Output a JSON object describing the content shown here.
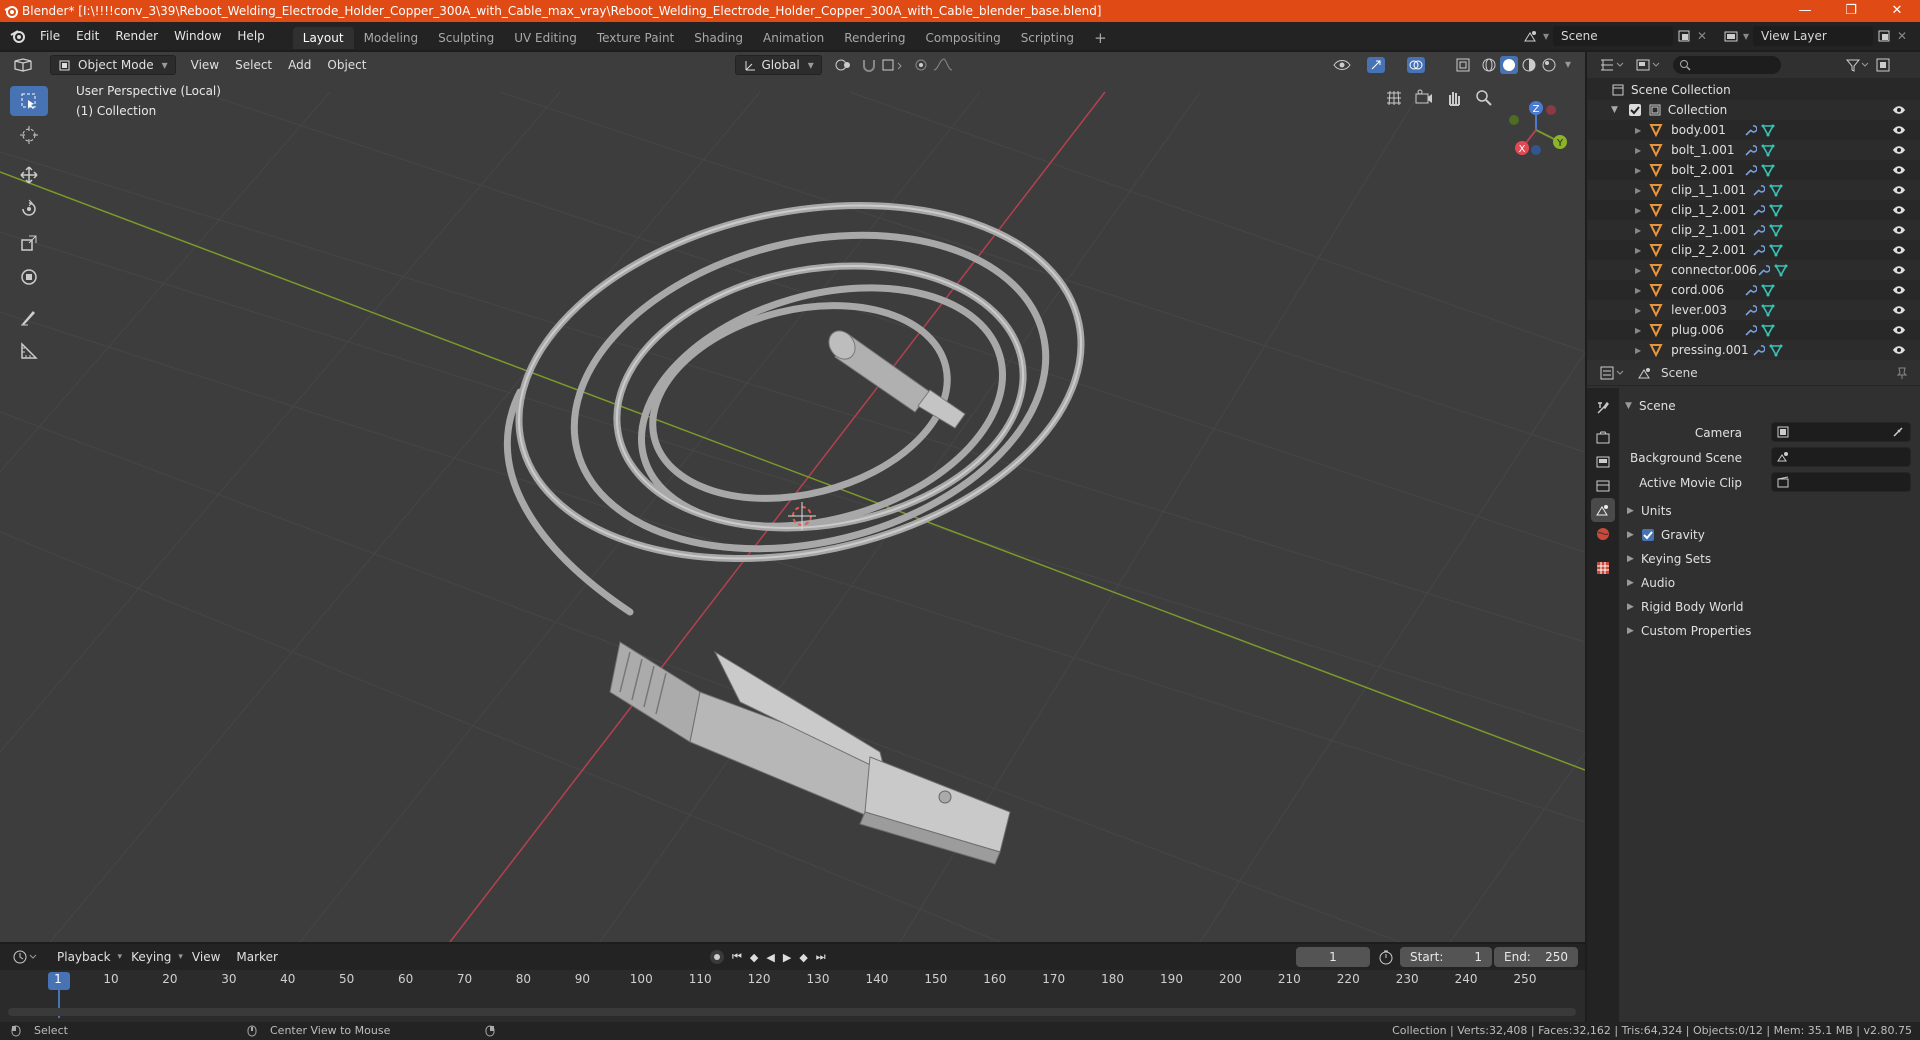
{
  "window": {
    "title": "Blender* [I:\\!!!!conv_3\\39\\Reboot_Welding_Electrode_Holder_Copper_300A_with_Cable_max_vray\\Reboot_Welding_Electrode_Holder_Copper_300A_with_Cable_blender_base.blend]",
    "minimize": "—",
    "maximize": "❐",
    "close": "✕"
  },
  "menubar": {
    "items": [
      "File",
      "Edit",
      "Render",
      "Window",
      "Help"
    ],
    "workspaces": [
      "Layout",
      "Modeling",
      "Sculpting",
      "UV Editing",
      "Texture Paint",
      "Shading",
      "Animation",
      "Rendering",
      "Compositing",
      "Scripting"
    ],
    "active_workspace": "Layout",
    "add_tab": "+",
    "scene_name": "Scene",
    "view_layer": "View Layer"
  },
  "viewport": {
    "mode": "Object Mode",
    "menus": [
      "View",
      "Select",
      "Add",
      "Object"
    ],
    "orientation": "Global",
    "perspective_label": "User Perspective (Local)",
    "collection_label": "(1) Collection",
    "gizmo_axes": {
      "x": "X",
      "y": "Y",
      "z": "Z"
    }
  },
  "timeline": {
    "menus": [
      "Playback",
      "Keying",
      "View",
      "Marker"
    ],
    "current_frame": "1",
    "start_label": "Start:",
    "start_value": "1",
    "end_label": "End:",
    "end_value": "250",
    "frame_markers": [
      "1",
      "10",
      "20",
      "30",
      "40",
      "50",
      "60",
      "70",
      "80",
      "90",
      "100",
      "110",
      "120",
      "130",
      "140",
      "150",
      "160",
      "170",
      "180",
      "190",
      "200",
      "210",
      "220",
      "230",
      "240",
      "250"
    ]
  },
  "statusbar": {
    "left_hint": "Select",
    "middle_hint": "Center View to Mouse",
    "stats": "Collection | Verts:32,408 | Faces:32,162 | Tris:64,324 | Objects:0/12 | Mem: 35.1 MB | v2.80.75"
  },
  "outliner": {
    "root": "Scene Collection",
    "collection": "Collection",
    "objects": [
      "body.001",
      "bolt_1.001",
      "bolt_2.001",
      "clip_1_1.001",
      "clip_1_2.001",
      "clip_2_1.001",
      "clip_2_2.001",
      "connector.006",
      "cord.006",
      "lever.003",
      "plug.006",
      "pressing.001"
    ]
  },
  "properties": {
    "header_title": "Scene",
    "panel_title": "Scene",
    "fields": {
      "camera_label": "Camera",
      "background_scene_label": "Background Scene",
      "active_movie_clip_label": "Active Movie Clip"
    },
    "panels": [
      "Units",
      "Gravity",
      "Keying Sets",
      "Audio",
      "Rigid Body World",
      "Custom Properties"
    ],
    "gravity_checked": true
  },
  "colors": {
    "title_bar": "#e04a14",
    "accent_blue": "#4772b3",
    "axis_red": "#b3414f",
    "axis_green": "#7a9a2c",
    "object_orange": "#e8943a",
    "mesh_teal": "#36c3b4"
  }
}
